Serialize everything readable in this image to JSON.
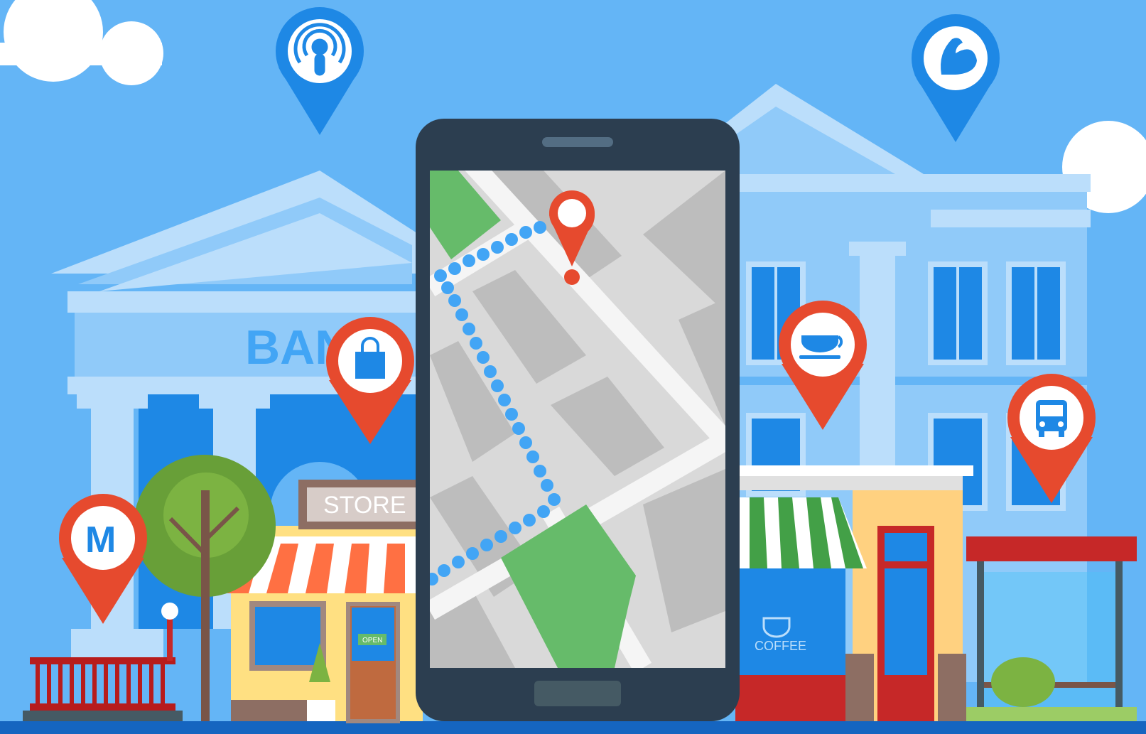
{
  "scene": {
    "bank_sign": "BANK",
    "store_sign": "STORE",
    "open_sign": "OPEN",
    "coffee_sign": "COFFEE",
    "metro_pin_letter": "M"
  },
  "pins": [
    {
      "name": "podcast-pin",
      "icon": "podcast-icon",
      "color": "#1e88e5"
    },
    {
      "name": "gym-pin",
      "icon": "muscle-arm-icon",
      "color": "#1e88e5"
    },
    {
      "name": "shopping-pin",
      "icon": "shopping-bag-icon",
      "color": "#e64a2e"
    },
    {
      "name": "coffee-pin",
      "icon": "coffee-cup-icon",
      "color": "#e64a2e"
    },
    {
      "name": "bus-pin",
      "icon": "bus-icon",
      "color": "#e64a2e"
    },
    {
      "name": "metro-pin",
      "icon": "metro-icon",
      "color": "#e64a2e"
    },
    {
      "name": "destination-pin",
      "icon": "location-pin-icon",
      "color": "#e64a2e"
    }
  ],
  "colors": {
    "sky": "#64b5f6",
    "building": "#90caf9",
    "phone_body": "#2c3e50",
    "map_bg": "#d9d9d9",
    "route_dots": "#42a5f5",
    "park": "#66bb6a"
  }
}
